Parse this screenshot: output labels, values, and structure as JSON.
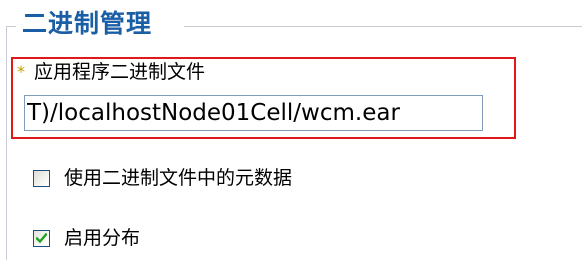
{
  "group": {
    "title": "二进制管理"
  },
  "field": {
    "required_marker": "*",
    "label": "应用程序二进制文件",
    "value": "T)/localhostNode01Cell/wcm.ear"
  },
  "options": [
    {
      "label": "使用二进制文件中的元数据",
      "checked": false
    },
    {
      "label": "启用分布",
      "checked": true
    }
  ],
  "colors": {
    "title": "#1a5ea6",
    "highlight_border": "#e01818",
    "required_marker": "#c8a000",
    "checkmark": "#21a121"
  }
}
